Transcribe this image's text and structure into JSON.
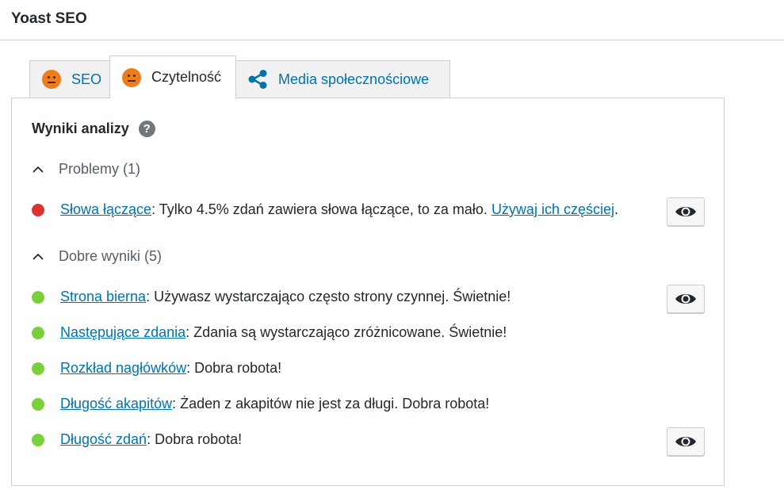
{
  "panel": {
    "title": "Yoast SEO"
  },
  "tabs": [
    {
      "label": "SEO",
      "icon": "orange-neutral-face-icon"
    },
    {
      "label": "Czytelność",
      "icon": "orange-neutral-face-icon",
      "active": true
    },
    {
      "label": "Media społecznościowe",
      "icon": "share-icon"
    }
  ],
  "analysis": {
    "heading": "Wyniki analizy",
    "help_icon": "question-mark-icon",
    "problems": {
      "title": "Problemy (1)",
      "items": [
        {
          "link": "Słowa łączące",
          "text_before": ": Tylko 4.5% zdań zawiera słowa łączące, to za mało. ",
          "link2": "Używaj ich częściej",
          "text_after": ".",
          "status": "bad",
          "has_eye": true
        }
      ]
    },
    "good": {
      "title": "Dobre wyniki (5)",
      "items": [
        {
          "link": "Strona bierna",
          "text": ": Używasz wystarczająco często strony czynnej. Świetnie!",
          "status": "good",
          "has_eye": true
        },
        {
          "link": "Następujące zdania",
          "text": ": Zdania są wystarczająco zróżnicowane. Świetnie!",
          "status": "good",
          "has_eye": false
        },
        {
          "link": "Rozkład nagłówków",
          "text": ": Dobra robota!",
          "status": "good",
          "has_eye": false
        },
        {
          "link": "Długość akapitów",
          "text": ": Żaden z akapitów nie jest za długi. Dobra robota!",
          "status": "good",
          "has_eye": false
        },
        {
          "link": "Długość zdań",
          "text": ": Dobra robota!",
          "status": "good",
          "has_eye": true
        }
      ]
    }
  },
  "colors": {
    "bad": "#dc3232",
    "good": "#7ad03a",
    "neutral_face": "#ee7c1b",
    "link": "#0073aa"
  }
}
